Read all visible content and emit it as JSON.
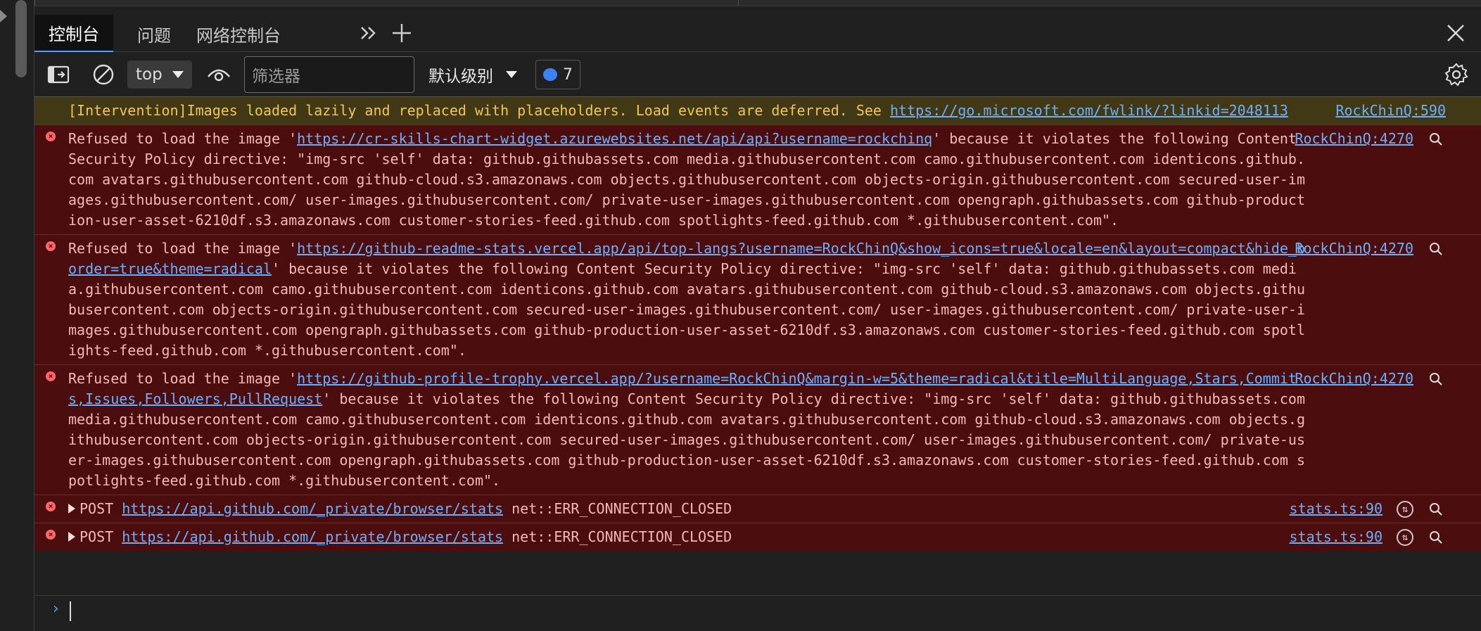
{
  "tabs": [
    "控制台",
    "问题",
    "网络控制台"
  ],
  "toolbar": {
    "context": "top",
    "filter_placeholder": "筛选器",
    "level": "默认级别",
    "message_count": "7"
  },
  "messages": [
    {
      "type": "warning",
      "text": "[Intervention]Images loaded lazily and replaced with placeholders. Load events are deferred. See ",
      "link": "https://go.microsoft.com/fwlink/?linkid=2048113",
      "source": "RockChinQ:590"
    },
    {
      "type": "error",
      "prefix": "Refused to load the image '",
      "link": "https://cr-skills-chart-widget.azurewebsites.net/api/api?username=rockchinq",
      "suffix": "' because it violates the following Content Security Policy directive: \"img-src 'self' data: github.githubassets.com media.githubusercontent.com camo.githubusercontent.com identicons.github.com avatars.githubusercontent.com github-cloud.s3.amazonaws.com objects.githubusercontent.com objects-origin.githubusercontent.com secured-user-images.githubusercontent.com/ user-images.githubusercontent.com/ private-user-images.githubusercontent.com opengraph.githubassets.com github-production-user-asset-6210df.s3.amazonaws.com customer-stories-feed.github.com spotlights-feed.github.com *.githubusercontent.com\".",
      "source": "RockChinQ:4270"
    },
    {
      "type": "error",
      "prefix": "Refused to load the image '",
      "link": "https://github-readme-stats.vercel.app/api/top-langs?username=RockChinQ&show_icons=true&locale=en&layout=compact&hide_border=true&theme=radical",
      "suffix": "' because it violates the following Content Security Policy directive: \"img-src 'self' data: github.githubassets.com media.githubusercontent.com camo.githubusercontent.com identicons.github.com avatars.githubusercontent.com github-cloud.s3.amazonaws.com objects.githubusercontent.com objects-origin.githubusercontent.com secured-user-images.githubusercontent.com/ user-images.githubusercontent.com/ private-user-images.githubusercontent.com opengraph.githubassets.com github-production-user-asset-6210df.s3.amazonaws.com customer-stories-feed.github.com spotlights-feed.github.com *.githubusercontent.com\".",
      "source": "RockChinQ:4270"
    },
    {
      "type": "error",
      "prefix": "Refused to load the image '",
      "link": "https://github-profile-trophy.vercel.app/?username=RockChinQ&margin-w=5&theme=radical&title=MultiLanguage,Stars,Commits,Issues,Followers,PullRequest",
      "suffix": "' because it violates the following Content Security Policy directive: \"img-src 'self' data: github.githubassets.com media.githubusercontent.com camo.githubusercontent.com identicons.github.com avatars.githubusercontent.com github-cloud.s3.amazonaws.com objects.githubusercontent.com objects-origin.githubusercontent.com secured-user-images.githubusercontent.com/ user-images.githubusercontent.com/ private-user-images.githubusercontent.com opengraph.githubassets.com github-production-user-asset-6210df.s3.amazonaws.com customer-stories-feed.github.com spotlights-feed.github.com *.githubusercontent.com\".",
      "source": "RockChinQ:4270"
    },
    {
      "type": "network",
      "method": "POST",
      "link": "https://api.github.com/_private/browser/stats",
      "status": "net::ERR_CONNECTION_CLOSED",
      "source": "stats.ts:90"
    },
    {
      "type": "network",
      "method": "POST",
      "link": "https://api.github.com/_private/browser/stats",
      "status": "net::ERR_CONNECTION_CLOSED",
      "source": "stats.ts:90"
    }
  ],
  "prompt_symbol": "›",
  "icons": {
    "sidebar": "sidebar-toggle-icon",
    "clear": "clear-console-icon",
    "eye": "live-expression-icon",
    "settings": "gear-icon",
    "close": "close-icon",
    "more_tabs": "more-tabs-icon",
    "add_tab": "add-tab-icon"
  },
  "colors": {
    "warning_bg": "#413915",
    "error_bg": "#4b0d0d",
    "link": "#6ab0ff",
    "accent": "#4ea1ff"
  }
}
